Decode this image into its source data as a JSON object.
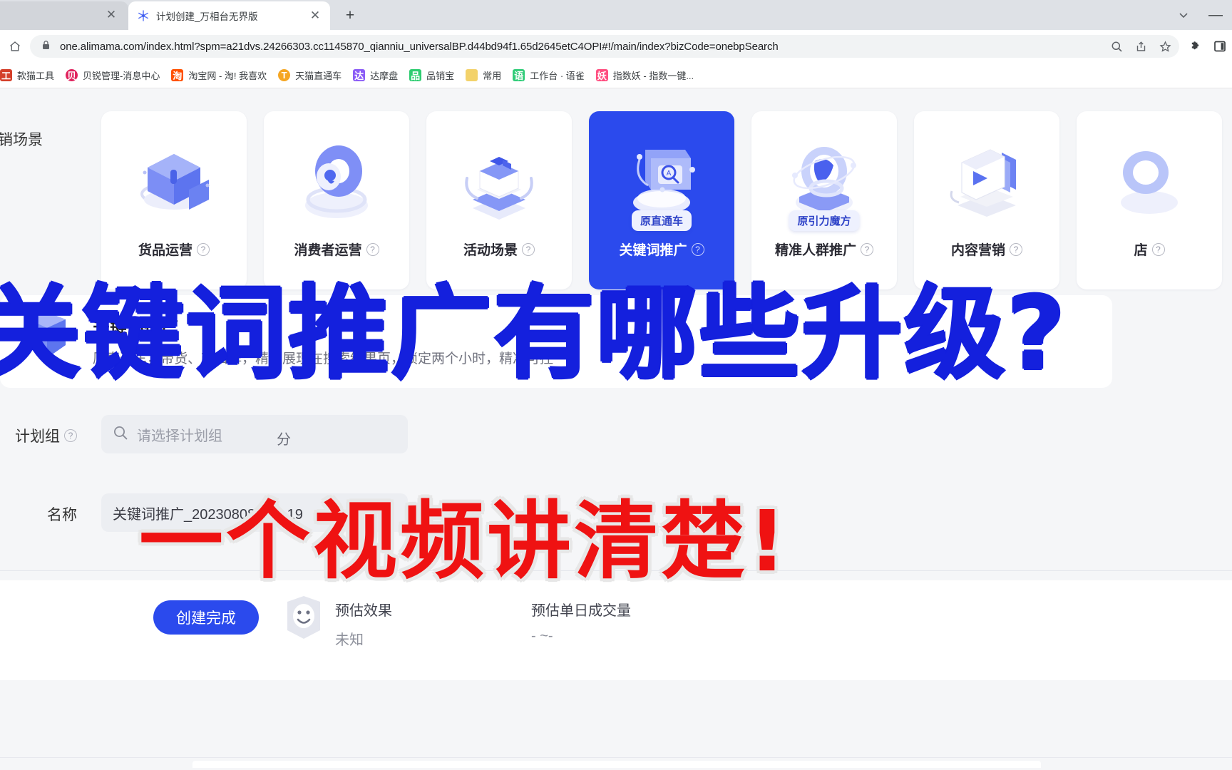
{
  "browser": {
    "tab_background_close": "✕",
    "active_tab": {
      "title": "计划创建_万相台无界版",
      "favicon": "snowflake-icon",
      "close": "✕"
    },
    "new_tab": "+",
    "window_chevron": "chevron-down-icon",
    "window_minimize": "—",
    "home_icon": "home-icon",
    "lock_icon": "lock-icon",
    "url": "one.alimama.com/index.html?spm=a21dvs.24266303.cc1145870_qianniu_universalBP.d44bd94f1.65d2645etC4OPI#!/main/index?bizCode=onebpSearch",
    "omnibox_icons": [
      "zoom-search-icon",
      "share-icon",
      "bookmark-star-icon"
    ],
    "toolbar_icons": [
      "extensions-puzzle-icon",
      "side-panel-icon"
    ],
    "bookmarks": [
      {
        "label": "款猫工具",
        "color": "#d43f2a"
      },
      {
        "label": "贝锐管理-消息中心",
        "color": "#e0245e"
      },
      {
        "label": "淘宝网 - 淘! 我喜欢",
        "color": "#ff5000"
      },
      {
        "label": "天猫直通车",
        "color": "#f5a623"
      },
      {
        "label": "达摩盘",
        "color": "#8b5cf6"
      },
      {
        "label": "品销宝",
        "color": "#2ecc71"
      },
      {
        "label": "常用",
        "color": "#f3d26a"
      },
      {
        "label": "工作台 · 语雀",
        "color": "#31cc79"
      },
      {
        "label": "指数妖 - 指数一键...",
        "color": "#ff4f81"
      }
    ]
  },
  "page": {
    "scene_section_label": "营销场景",
    "scene_cards": [
      {
        "name": "货品运营",
        "help": "?",
        "badge": "",
        "selected": false,
        "art": "box-cube-art"
      },
      {
        "name": "消费者运营",
        "help": "?",
        "badge": "",
        "selected": false,
        "art": "ring-disc-art"
      },
      {
        "name": "活动场景",
        "help": "?",
        "badge": "",
        "selected": false,
        "art": "gift-box-art"
      },
      {
        "name": "关键词推广",
        "help": "?",
        "badge": "原直通车",
        "selected": true,
        "art": "search-screen-art"
      },
      {
        "name": "精准人群推广",
        "help": "?",
        "badge": "原引力魔方",
        "selected": false,
        "art": "orbit-ring-art"
      },
      {
        "name": "内容营销",
        "help": "?",
        "badge": "",
        "selected": false,
        "art": "video-card-art"
      },
      {
        "name": "店",
        "help": "?",
        "badge": "",
        "selected": false,
        "art": "shop-art"
      }
    ],
    "description": {
      "title": "关键词推广",
      "subtitle": "原直通车，带货、带口碑，精准展现在搜索结果页，锁定两个小时，精准可控"
    },
    "form": [
      {
        "label": "计划组",
        "help": "?",
        "type": "search",
        "placeholder": "请选择计划组",
        "value": "",
        "suffix": "分"
      },
      {
        "label": "名称",
        "help": "",
        "type": "text",
        "placeholder": "",
        "value": "关键词推广_20230808_14..19",
        "suffix": ""
      }
    ],
    "footer": {
      "create_button": "创建完成",
      "robot_icon": "robot-face-icon",
      "estimate_1_title": "预估效果",
      "estimate_1_value": "未知",
      "estimate_2_title": "预估单日成交量",
      "estimate_2_value": "- ~-"
    }
  },
  "overlay": {
    "line_blue": "关键词推广有哪些升级?",
    "line_red": "一个视频讲清楚!",
    "color_blue": "#1420dd",
    "color_red": "#ef1212"
  }
}
